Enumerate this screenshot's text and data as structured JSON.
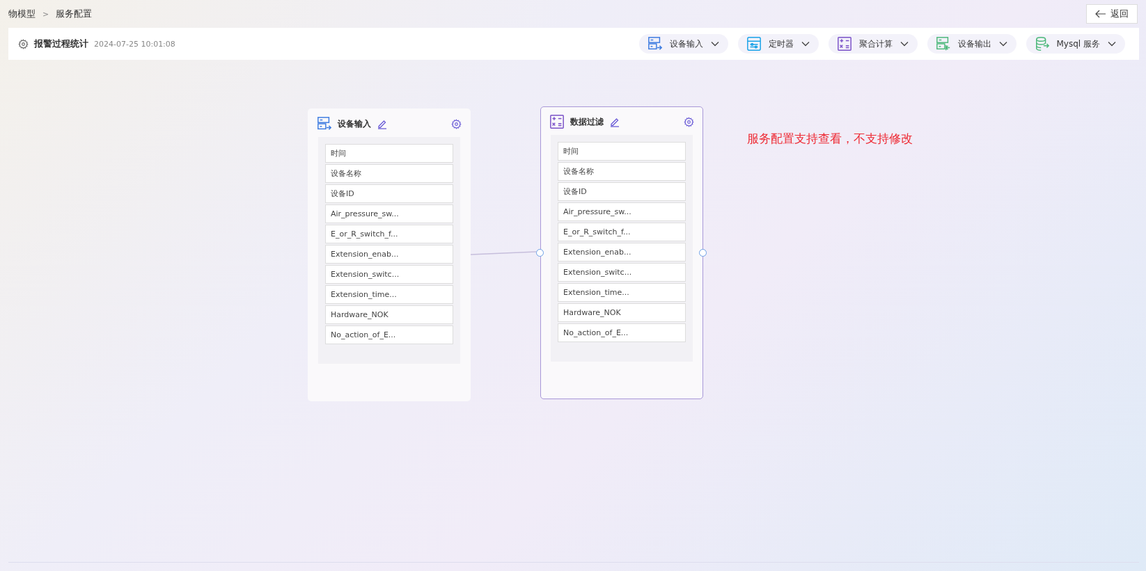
{
  "breadcrumb": [
    {
      "label": "物模型"
    },
    {
      "label": "服务配置"
    }
  ],
  "breadcrumb_separator": ">",
  "back_button": {
    "label": "返回"
  },
  "header": {
    "title": "报警过程统计",
    "timestamp": "2024-07-25 10:01:08"
  },
  "toolbar": [
    {
      "kind": "device-input",
      "label": "设备输入"
    },
    {
      "kind": "timer",
      "label": "定时器"
    },
    {
      "kind": "calc",
      "label": "聚合计算"
    },
    {
      "kind": "device-output",
      "label": "设备输出"
    },
    {
      "kind": "database",
      "label": "Mysql 服务"
    }
  ],
  "nodes": [
    {
      "kind": "device-input",
      "title": "设备输入",
      "selected": false,
      "fields": [
        "时间",
        "设备名称",
        "设备ID",
        "Air_pressure_sw...",
        "E_or_R_switch_f...",
        "Extension_enab...",
        "Extension_switc...",
        "Extension_time...",
        "Hardware_NOK",
        "No_action_of_E..."
      ]
    },
    {
      "kind": "calc",
      "title": "数据过滤",
      "selected": true,
      "fields": [
        "时间",
        "设备名称",
        "设备ID",
        "Air_pressure_sw...",
        "E_or_R_switch_f...",
        "Extension_enab...",
        "Extension_switc...",
        "Extension_time...",
        "Hardware_NOK",
        "No_action_of_E..."
      ]
    }
  ],
  "note": "服务配置支持查看，不支持修改"
}
